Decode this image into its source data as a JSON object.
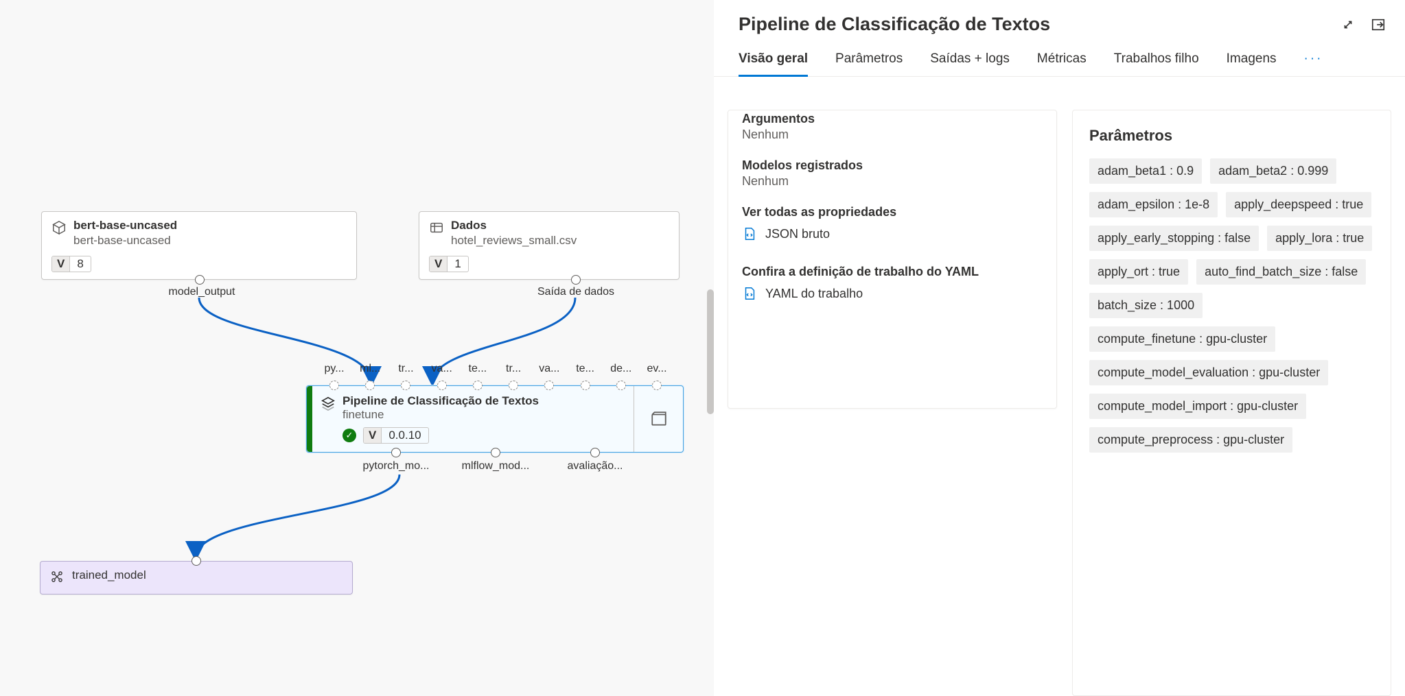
{
  "panel_title": "Pipeline de Classificação de Textos",
  "tab_labels": [
    "Visão geral",
    "Parâmetros",
    "Saídas + logs",
    "Métricas",
    "Trabalhos filho",
    "Imagens"
  ],
  "overflow_glyph": "···",
  "left_card": {
    "arguments_title": "Argumentos",
    "arguments_value": "Nenhum",
    "models_title": "Modelos registrados",
    "models_value": "Nenhum",
    "props_title": "Ver todas as propriedades",
    "raw_json_label": "JSON bruto",
    "yaml_title": "Confira a definição de trabalho do YAML",
    "yaml_link_label": "YAML do trabalho"
  },
  "params_heading": "Parâmetros",
  "params_chips": [
    "adam_beta1 : 0.9",
    "adam_beta2 : 0.999",
    "adam_epsilon : 1e-8",
    "apply_deepspeed : true",
    "apply_early_stopping : false",
    "apply_lora : true",
    "apply_ort : true",
    "auto_find_batch_size : false",
    "batch_size : 1000",
    "compute_finetune : gpu-cluster",
    "compute_model_evaluation : gpu-cluster",
    "compute_model_import : gpu-cluster",
    "compute_preprocess : gpu-cluster"
  ],
  "nodes": {
    "bert": {
      "title": "bert-base-uncased",
      "subtitle": "bert-base-uncased",
      "version_letter": "V",
      "version": "8",
      "out_label": "model_output"
    },
    "data": {
      "title": "Dados",
      "subtitle": "hotel_reviews_small.csv",
      "version_letter": "V",
      "version": "1",
      "out_label": "Saída de dados"
    },
    "pipeline": {
      "title": "Pipeline de Classificação de Textos",
      "subtitle": "finetune",
      "version_letter": "V",
      "version": "0.0.10",
      "in_labels": [
        "py...",
        "ml...",
        "tr...",
        "va...",
        "te...",
        "tr...",
        "va...",
        "te...",
        "de...",
        "ev..."
      ],
      "out_labels": [
        "pytorch_mo...",
        "mlflow_mod...",
        "avaliação..."
      ]
    },
    "result": {
      "title": "trained_model"
    }
  }
}
